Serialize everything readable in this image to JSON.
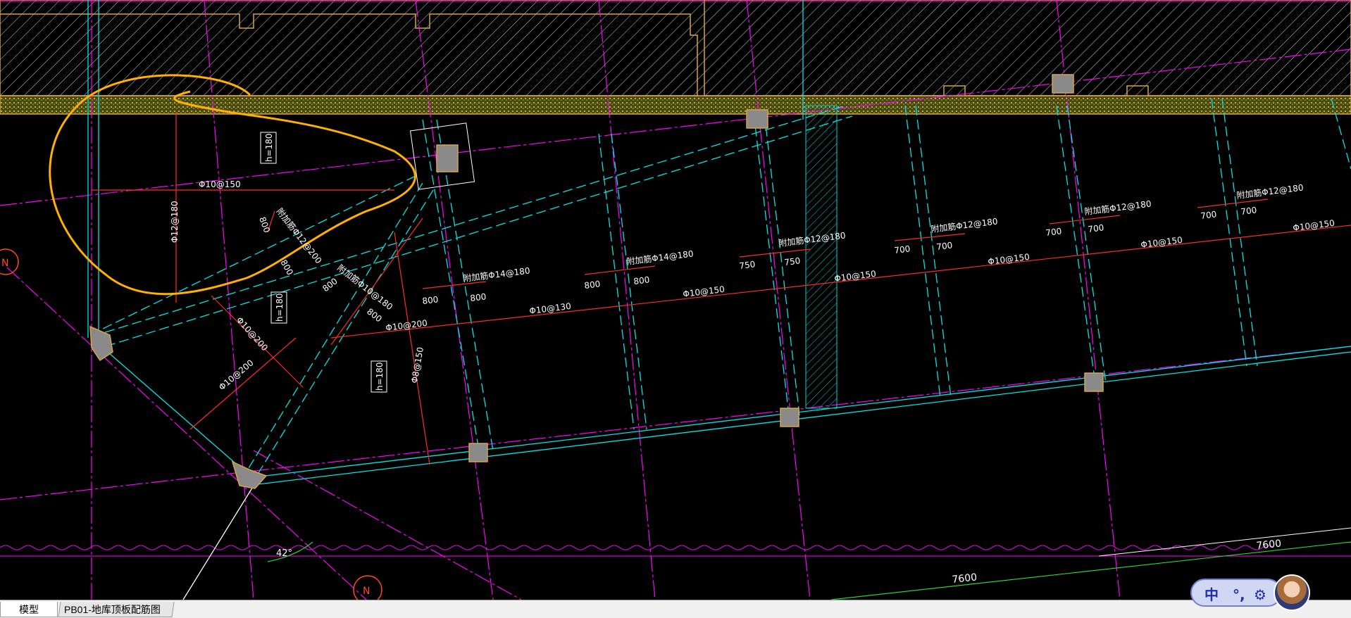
{
  "tabs": {
    "model": "模型",
    "layout": "PB01-地库顶板配筋图"
  },
  "ime": {
    "lang": "中",
    "punct": "°,",
    "skin": "⚙"
  },
  "drawing": {
    "h180_a": "h=180",
    "h180_b": "h=180",
    "h180_c": "h=180",
    "r_10_150_top": "Φ10@150",
    "r_12_180_v": "Φ12@180",
    "r_add_12_200": "附加筋Φ12@200",
    "r_add_10_180": "附加筋Φ10@180",
    "r_10_200_a": "Φ10@200",
    "r_10_200_b": "Φ10@200",
    "r_10_200_c": "Φ10@200",
    "r_8_150_v": "Φ8@150",
    "r_add_14_180_a": "附加筋Φ14@180",
    "r_10_130": "Φ10@130",
    "r_add_14_180_b": "附加筋Φ14@180",
    "r_10_150_a": "Φ10@150",
    "r_add_12_180_a": "附加筋Φ12@180",
    "r_10_150_b": "Φ10@150",
    "r_add_12_180_b": "附加筋Φ12@180",
    "r_10_150_c": "Φ10@150",
    "r_add_12_180_c": "附加筋Φ12@180",
    "r_10_150_d": "Φ10@150",
    "r_add_12_180_d": "附加筋Φ12@180",
    "r_10_150_e": "Φ10@150",
    "d800_1": "800",
    "d800_2": "800",
    "d800_3": "800",
    "d800_4": "800",
    "d800_5": "800",
    "d800_6": "800",
    "d800_7": "800",
    "d800_8": "800",
    "d750_1": "750",
    "d750_2": "750",
    "d700_1": "700",
    "d700_2": "700",
    "d700_3": "700",
    "d700_4": "700",
    "d700_5": "700",
    "d700_6": "700",
    "angle": "42°",
    "span_a": "7600",
    "span_b": "7600",
    "north_a": "N",
    "north_b": "N"
  },
  "colors": {
    "background": "#000000",
    "rebar": "#ff2a2a",
    "grid_axis": "#ff00ff",
    "beam_edge": "#00e5e5",
    "wall_fill": "#d9a441",
    "annotation_stroke": "#ffb000",
    "text": "#ffffff",
    "column": "#8a8a8a",
    "dimension_green": "#2ed12e"
  }
}
